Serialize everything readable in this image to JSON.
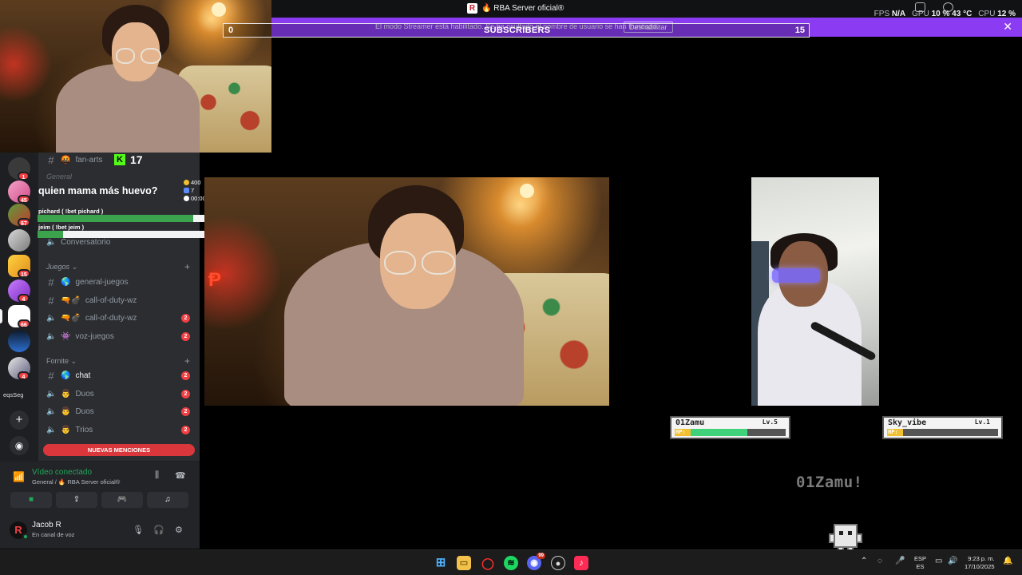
{
  "window": {
    "title": "🔥 RBA Server oficial®",
    "logo_letter": "R",
    "fps_label": "FPS",
    "fps_value": "N/A",
    "gpu_label": "GPU",
    "gpu_value": "10 % 43 °C",
    "cpu_label": "CPU",
    "cpu_value": "12 %"
  },
  "banner": {
    "message": "El modo Streamer está habilitado. Se ha ocultado el nombre de usuario se han truncado.",
    "button": "Deshabilitar",
    "close": "✕"
  },
  "subscribers": {
    "label": "SUBSCRIBERS",
    "min": "0",
    "max": "15"
  },
  "poll": {
    "question": "quien mama más huevo?",
    "coins": "400",
    "voters": "7",
    "timer": "00:00",
    "options": [
      {
        "label": "pichard ( !bet pichard )",
        "share": 0.86
      },
      {
        "label": "jeim ( !bet jeim )",
        "share": 0.14
      }
    ]
  },
  "kick": {
    "letter": "K",
    "count": "17"
  },
  "servers": [
    {
      "badge": "1"
    },
    {
      "badge": "45"
    },
    {
      "badge": "67"
    },
    {
      "badge": ""
    },
    {
      "badge": "15"
    },
    {
      "badge": "4"
    },
    {
      "badge": "66"
    },
    {
      "badge": ""
    },
    {
      "badge": "4"
    }
  ],
  "server_folder_label": "eqsSeg",
  "channels": {
    "top_channel": "fan-arts",
    "hidden_category": "General",
    "voice_room": "Conversatorio",
    "categories": [
      {
        "name": "Juegos",
        "items": [
          {
            "type": "text",
            "emoji": "🌎",
            "name": "general-juegos",
            "count": ""
          },
          {
            "type": "text",
            "emoji": "🔫💣",
            "name": "call-of-duty-wz",
            "count": ""
          },
          {
            "type": "voice",
            "emoji": "🔫💣",
            "name": "call-of-duty-wz",
            "count": "2"
          },
          {
            "type": "voice",
            "emoji": "👾",
            "name": "voz-juegos",
            "count": "2"
          }
        ]
      },
      {
        "name": "Fornite",
        "items": [
          {
            "type": "text",
            "emoji": "🌎",
            "name": "chat",
            "count": "2"
          },
          {
            "type": "voice",
            "emoji": "👨",
            "name": "Duos",
            "count": "2"
          },
          {
            "type": "voice",
            "emoji": "👨",
            "name": "Duos",
            "count": "2"
          },
          {
            "type": "voice",
            "emoji": "👨",
            "name": "Trios",
            "count": "2"
          }
        ]
      }
    ],
    "mentions_button": "NUEVAS MENCIONES"
  },
  "voice": {
    "status": "Vídeo conectado",
    "location": "General / 🔥 RBA Server oficial®"
  },
  "user": {
    "name": "Jacob R",
    "status": "En canal de voz",
    "avatar_letter": "R"
  },
  "battle": {
    "player1": {
      "name": "01Zamu",
      "level": "Lv.5",
      "hp": 0.6
    },
    "player2": {
      "name": "Sky_vibe",
      "level": "Lv.1",
      "hp": 0.0
    },
    "hp_label": "HP:",
    "shout": "01Zamu!"
  },
  "taskbar": {
    "discord_badge": "99",
    "lang_top": "ESP",
    "lang_bottom": "ES",
    "time": "9:23 p. m.",
    "date": "17/10/2025"
  },
  "colors": {
    "banner": "#8b3cf2",
    "discord_red": "#f23f43",
    "discord_green": "#23a55a",
    "kick_green": "#53fc18",
    "hp_green": "#3fd27a"
  }
}
